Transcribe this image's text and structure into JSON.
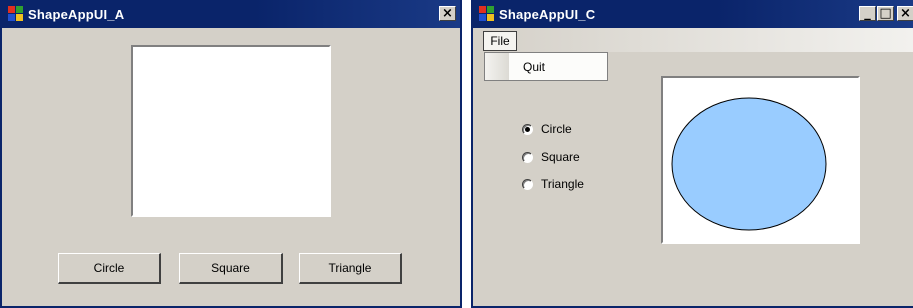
{
  "window_a": {
    "title": "ShapeAppUI_A",
    "close_glyph": "×",
    "buttons": {
      "circle": "Circle",
      "square": "Square",
      "triangle": "Triangle"
    }
  },
  "window_c": {
    "title": "ShapeAppUI_C",
    "minimize_glyph": "_",
    "maximize_glyph": "□",
    "close_glyph": "×",
    "menu": {
      "file": "File",
      "quit": "Quit"
    },
    "radios": [
      {
        "label": "Circle",
        "checked": true
      },
      {
        "label": "Square",
        "checked": false
      },
      {
        "label": "Triangle",
        "checked": false
      }
    ],
    "shape": {
      "type": "circle",
      "fill": "#99ccff",
      "stroke": "#000000"
    }
  },
  "colors": {
    "titlebar": "#0a246a",
    "face": "#d4d0c8"
  }
}
